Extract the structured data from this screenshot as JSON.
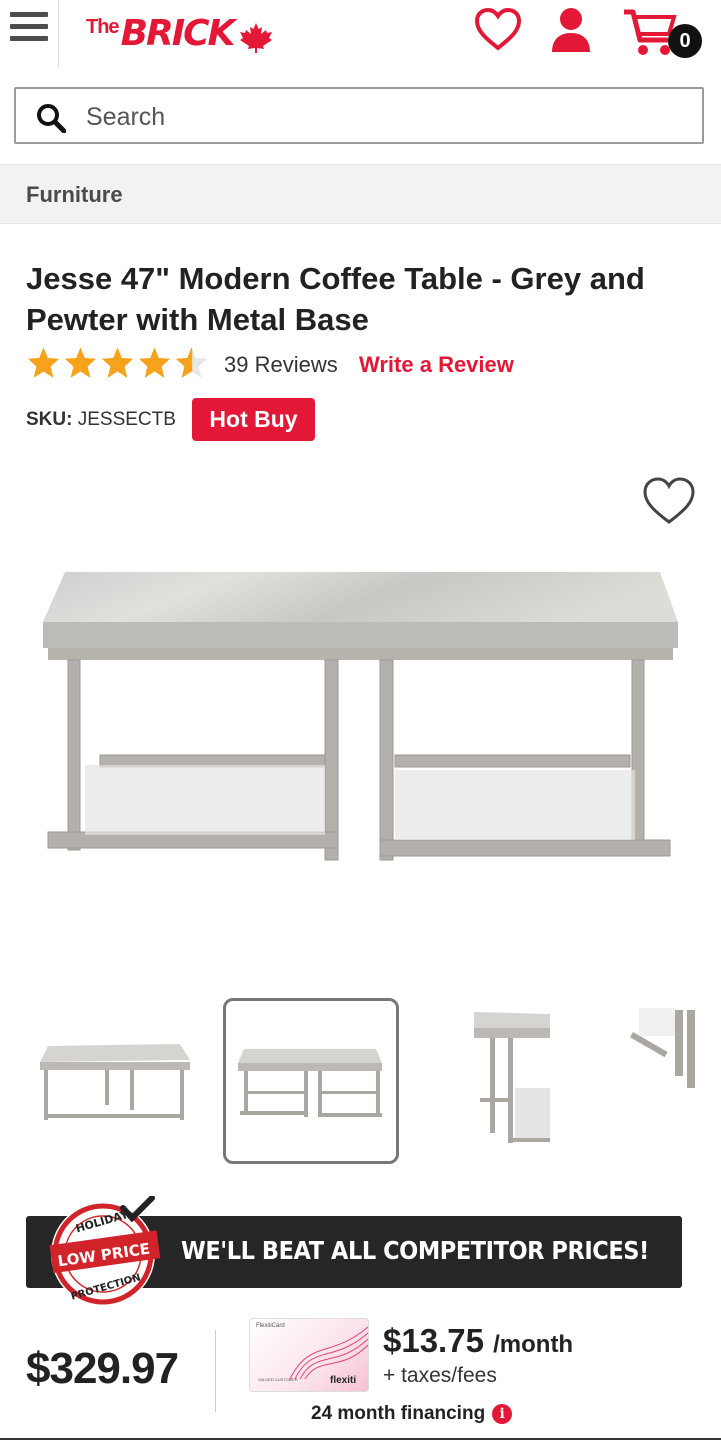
{
  "header": {
    "logo_the": "The",
    "logo_brick": "BRICK",
    "cart_count": "0"
  },
  "search": {
    "placeholder": "Search"
  },
  "breadcrumb": {
    "label": "Furniture"
  },
  "product": {
    "title": "Jesse 47\" Modern Coffee Table - Grey and Pewter with Metal Base",
    "rating": 4.5,
    "rating_max": 5,
    "reviews": "39 Reviews",
    "write_review": "Write a Review",
    "sku_label": "SKU:",
    "sku": "JESSECTB",
    "hot_buy": "Hot Buy"
  },
  "gallery": {
    "selected_index": 1,
    "thumbnail_count": 4
  },
  "promo": {
    "badge_top": "HOLIDAY",
    "badge_mid": "LOW PRICE",
    "badge_bottom": "PROTECTION",
    "headline": "WE'LL BEAT ALL COMPETITOR PRICES!"
  },
  "pricing": {
    "price": "$329.97",
    "card_name": "FlexitiCard",
    "card_brand": "flexiti",
    "card_holder": "VALUED CUSTOMER",
    "monthly": "$13.75",
    "per_month": "/month",
    "taxes": "+ taxes/fees",
    "financing": "24 month financing"
  },
  "colors": {
    "brand_red": "#e31837",
    "dark": "#262626",
    "star": "#f7a21b"
  }
}
